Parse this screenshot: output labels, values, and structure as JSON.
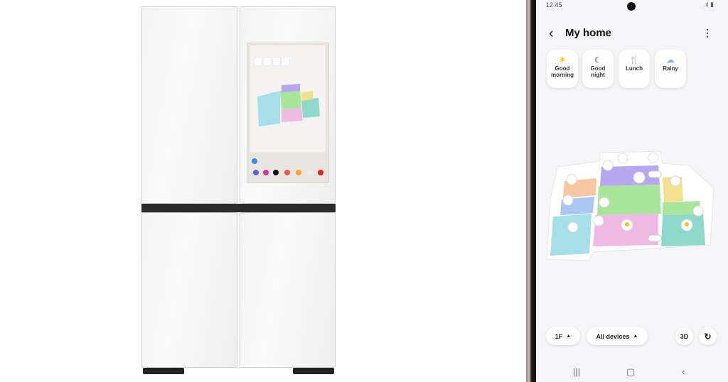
{
  "phone": {
    "status_time": "12:45",
    "title": "My home",
    "scenes": [
      {
        "label_1": "Good",
        "label_2": "morning",
        "icon": "sun-icon",
        "color": "#f5c518"
      },
      {
        "label_1": "Good",
        "label_2": "night",
        "icon": "moon-icon",
        "color": "#9b7cf0"
      },
      {
        "label_1": "Lunch",
        "label_2": "",
        "icon": "utensils-icon",
        "color": "#ef5a4a"
      },
      {
        "label_1": "Rainy",
        "label_2": "",
        "icon": "rain-cloud-icon",
        "color": "#8fb7e0"
      }
    ],
    "floor_label": "1F",
    "devices_label": "All devices",
    "view_3d_label": "3D",
    "rooms": [
      {
        "name": "purple",
        "color": "#b7a6f0"
      },
      {
        "name": "green",
        "color": "#a9e59a"
      },
      {
        "name": "orange",
        "color": "#f6c8a2"
      },
      {
        "name": "blue",
        "color": "#a9c7f2"
      },
      {
        "name": "cyan",
        "color": "#a7dfe8"
      },
      {
        "name": "pink",
        "color": "#efb9e6"
      },
      {
        "name": "yellow",
        "color": "#f3e08f"
      },
      {
        "name": "teal",
        "color": "#8fd8cc"
      }
    ]
  }
}
